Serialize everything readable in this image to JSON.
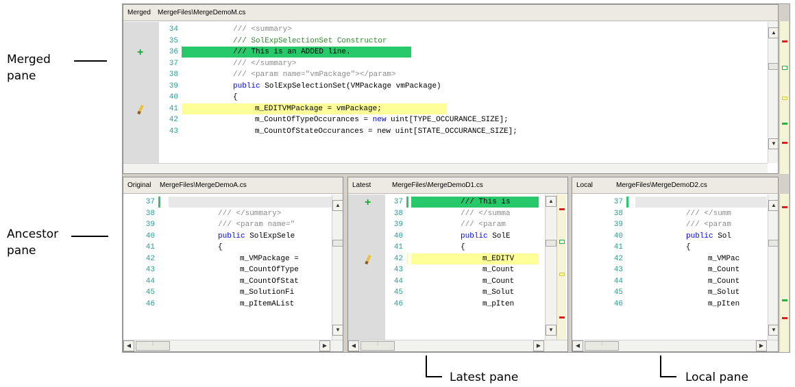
{
  "callouts": {
    "merged": [
      "Merged",
      "pane"
    ],
    "ancestor": [
      "Ancestor",
      "pane"
    ],
    "latest": "Latest pane",
    "local": "Local pane"
  },
  "panes": {
    "merged": {
      "label": "Merged",
      "path": "MergeFiles\\MergeDemoM.cs",
      "lines": [
        {
          "n": "34",
          "text": "/// <summary>",
          "style": "cm"
        },
        {
          "n": "35",
          "text": "/// SolExpSelectionSet Constructor",
          "style": "cm-green"
        },
        {
          "n": "36",
          "text": "/// This is an ADDED line.",
          "style": "added",
          "glyph": "plus-icon"
        },
        {
          "n": "37",
          "text": "/// </summary>",
          "style": "cm"
        },
        {
          "n": "38",
          "text": "/// <param name=\"vmPackage\"></param>",
          "style": "cm"
        },
        {
          "n": "39",
          "kw": "public",
          "text": " SolExpSelectionSet(VMPackage vmPackage)",
          "style": "kw"
        },
        {
          "n": "40",
          "text": "{",
          "style": "plain"
        },
        {
          "n": "41",
          "text": "    m_EDITVMPackage = vmPackage;",
          "style": "changed",
          "glyph": "pencil-icon"
        },
        {
          "n": "42",
          "text": "    m_CountOfTypeOccurances = ",
          "kw2": "new",
          "text2": " uint[TYPE_OCCURANCE_SIZE];",
          "style": "kw2"
        },
        {
          "n": "43",
          "text": "    m_CountOfStateOccurances = new uint[STATE_OCCURANCE_SIZE];",
          "style": "plain"
        }
      ]
    },
    "original": {
      "label": "Original",
      "path": "MergeFiles\\MergeDemoA.cs",
      "lines": [
        {
          "n": "37",
          "text": "",
          "style": "blank"
        },
        {
          "n": "38",
          "text": "/// </summary>",
          "style": "cm"
        },
        {
          "n": "39",
          "text": "/// <param name=\"",
          "style": "cm"
        },
        {
          "n": "40",
          "kw": "public",
          "text": " SolExpSele",
          "style": "kw"
        },
        {
          "n": "41",
          "text": "{",
          "style": "plain"
        },
        {
          "n": "42",
          "text": "    m_VMPackage =",
          "style": "plain"
        },
        {
          "n": "43",
          "text": "    m_CountOfType",
          "style": "plain"
        },
        {
          "n": "44",
          "text": "    m_CountOfStat",
          "style": "plain"
        },
        {
          "n": "45",
          "text": "    m_SolutionFi",
          "style": "plain"
        },
        {
          "n": "46",
          "text": "    m_pItemAList",
          "style": "plain"
        }
      ]
    },
    "latest": {
      "label": "Latest",
      "path": "MergeFiles\\MergeDemoD1.cs",
      "lines": [
        {
          "n": "37",
          "text": "/// This is",
          "style": "added",
          "glyph": "plus-icon"
        },
        {
          "n": "38",
          "text": "/// </summa",
          "style": "cm"
        },
        {
          "n": "39",
          "text": "/// <param",
          "style": "cm"
        },
        {
          "n": "40",
          "kw": "public",
          "text": " SolE",
          "style": "kw"
        },
        {
          "n": "41",
          "text": "{",
          "style": "plain"
        },
        {
          "n": "42",
          "text": "    m_EDITV",
          "style": "changed",
          "glyph": "pencil-icon"
        },
        {
          "n": "43",
          "text": "    m_Count",
          "style": "plain"
        },
        {
          "n": "44",
          "text": "    m_Count",
          "style": "plain"
        },
        {
          "n": "45",
          "text": "    m_Solut",
          "style": "plain"
        },
        {
          "n": "46",
          "text": "    m_pIten",
          "style": "plain"
        }
      ]
    },
    "local": {
      "label": "Local",
      "path": "MergeFiles\\MergeDemoD2.cs",
      "lines": [
        {
          "n": "37",
          "text": "",
          "style": "blank"
        },
        {
          "n": "38",
          "text": "/// </summ",
          "style": "cm"
        },
        {
          "n": "39",
          "text": "/// <param",
          "style": "cm"
        },
        {
          "n": "40",
          "kw": "public",
          "text": " Sol",
          "style": "kw"
        },
        {
          "n": "41",
          "text": "{",
          "style": "plain"
        },
        {
          "n": "42",
          "text": "    m_VMPac",
          "style": "plain"
        },
        {
          "n": "43",
          "text": "    m_Count",
          "style": "plain"
        },
        {
          "n": "44",
          "text": "    m_Count",
          "style": "plain"
        },
        {
          "n": "45",
          "text": "    m_Solut",
          "style": "plain"
        },
        {
          "n": "46",
          "text": "    m_pIten",
          "style": "plain"
        }
      ]
    }
  },
  "colors": {
    "added": "#26c86a",
    "changed": "#ffff99",
    "line_number": "#2a9d93",
    "keyword": "#0000ff"
  }
}
